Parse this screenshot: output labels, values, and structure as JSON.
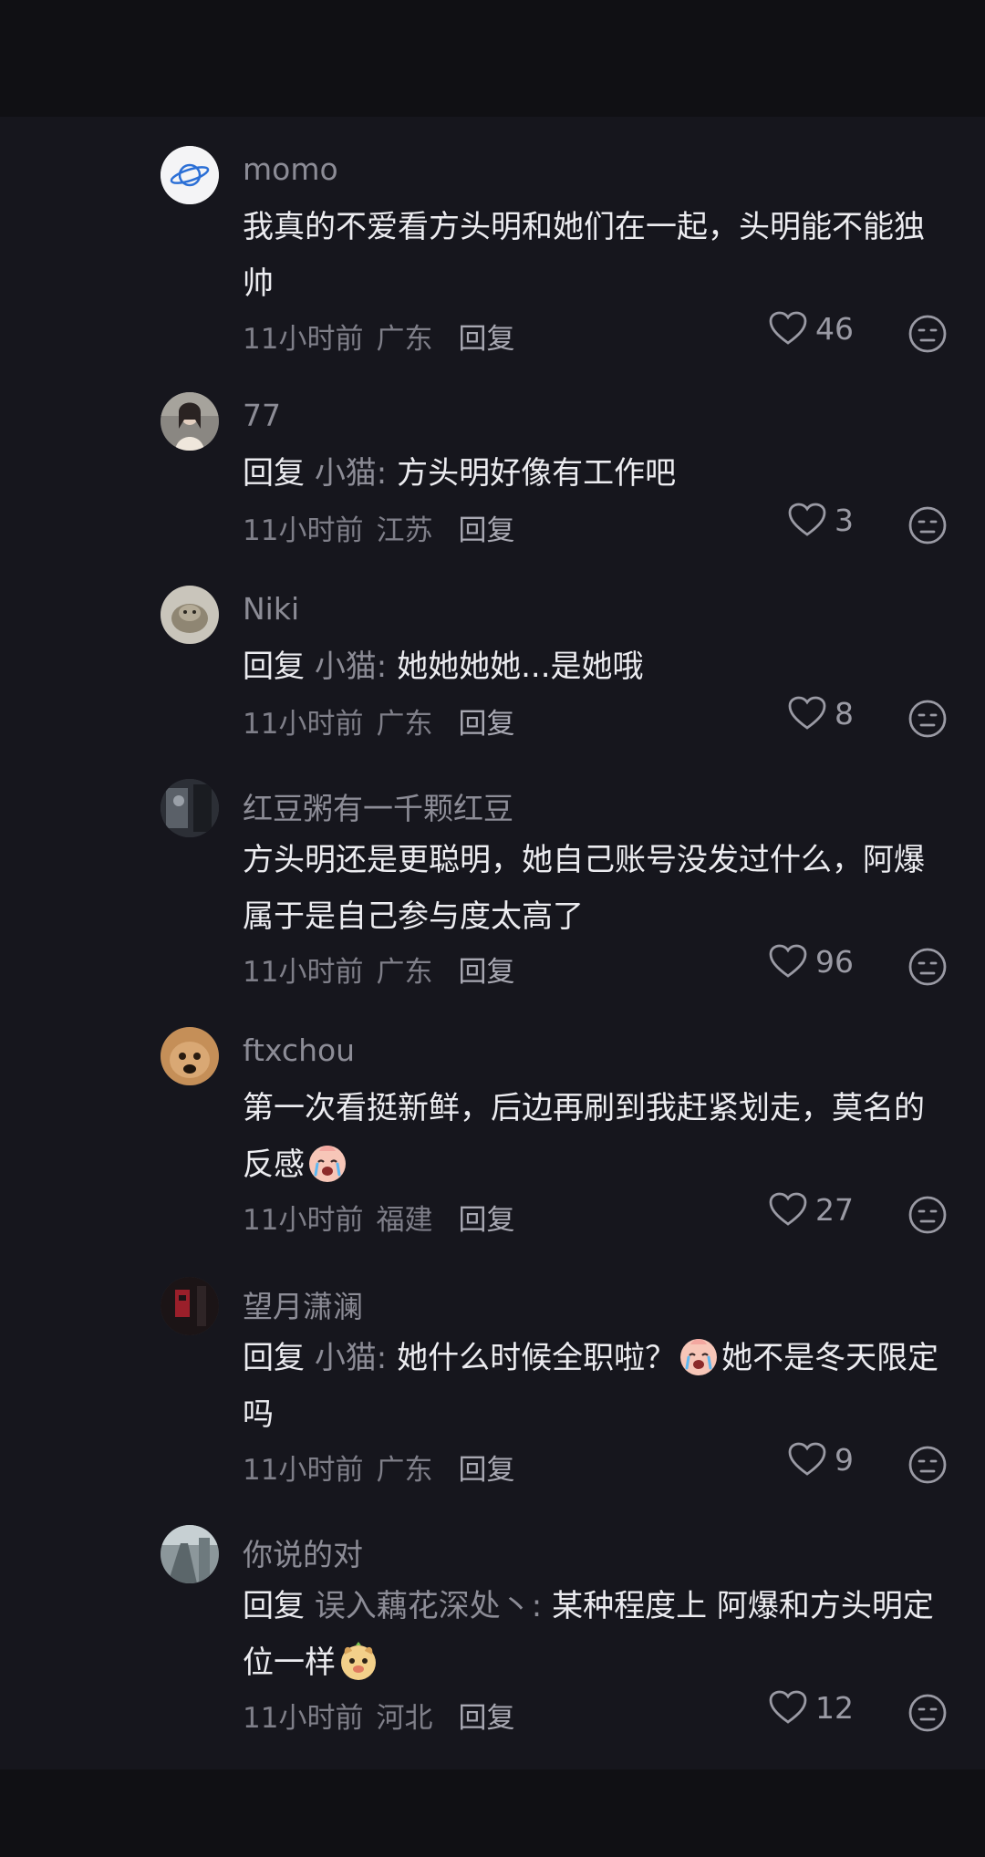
{
  "comments": [
    {
      "username": "momo",
      "reply_prefix": "",
      "reply_target": "",
      "text": "我真的不爱看方头明和她们在一起，头明能不能独帅",
      "text_after_emoji": "",
      "emoji": "",
      "time": "11小时前",
      "region": "广东",
      "reply_label": "回复",
      "likes": "46",
      "avatar_icon": "planet-icon"
    },
    {
      "username": "77",
      "reply_prefix": "回复",
      "reply_target": "小猫:",
      "text": "方头明好像有工作吧",
      "text_after_emoji": "",
      "emoji": "",
      "time": "11小时前",
      "region": "江苏",
      "reply_label": "回复",
      "likes": "3",
      "avatar_icon": "girl-photo"
    },
    {
      "username": "Niki",
      "reply_prefix": "回复",
      "reply_target": "小猫:",
      "text": "她她她她...是她哦",
      "text_after_emoji": "",
      "emoji": "",
      "time": "11小时前",
      "region": "广东",
      "reply_label": "回复",
      "likes": "8",
      "avatar_icon": "cat-photo"
    },
    {
      "username": "红豆粥有一千颗红豆",
      "reply_prefix": "",
      "reply_target": "",
      "text": "方头明还是更聪明，她自己账号没发过什么，阿爆属于是自己参与度太高了",
      "text_after_emoji": "",
      "emoji": "",
      "time": "11小时前",
      "region": "广东",
      "reply_label": "回复",
      "likes": "96",
      "avatar_icon": "dark-photo"
    },
    {
      "username": "ftxchou",
      "reply_prefix": "",
      "reply_target": "",
      "text": "第一次看挺新鲜，后边再刷到我赶紧划走，莫名的反感",
      "text_after_emoji": "",
      "emoji": "crying-emoji",
      "time": "11小时前",
      "region": "福建",
      "reply_label": "回复",
      "likes": "27",
      "avatar_icon": "cat-face-photo"
    },
    {
      "username": "望月潇澜",
      "reply_prefix": "回复",
      "reply_target": "小猫:",
      "text": "她什么时候全职啦？",
      "text_after_emoji": "她不是冬天限定吗",
      "emoji": "crying-emoji",
      "time": "11小时前",
      "region": "广东",
      "reply_label": "回复",
      "likes": "9",
      "avatar_icon": "red-dark-photo"
    },
    {
      "username": "你说的对",
      "reply_prefix": "回复",
      "reply_target": "误入藕花深处丶:",
      "text": "某种程度上 阿爆和方头明定位一样",
      "text_after_emoji": "",
      "emoji": "puppy-emoji",
      "time": "11小时前",
      "region": "河北",
      "reply_label": "回复",
      "likes": "12",
      "avatar_icon": "street-photo"
    }
  ],
  "colors": {
    "background": "#16161d",
    "username": "#8c8c96",
    "text": "#ececf0",
    "meta": "#7f7f89"
  }
}
